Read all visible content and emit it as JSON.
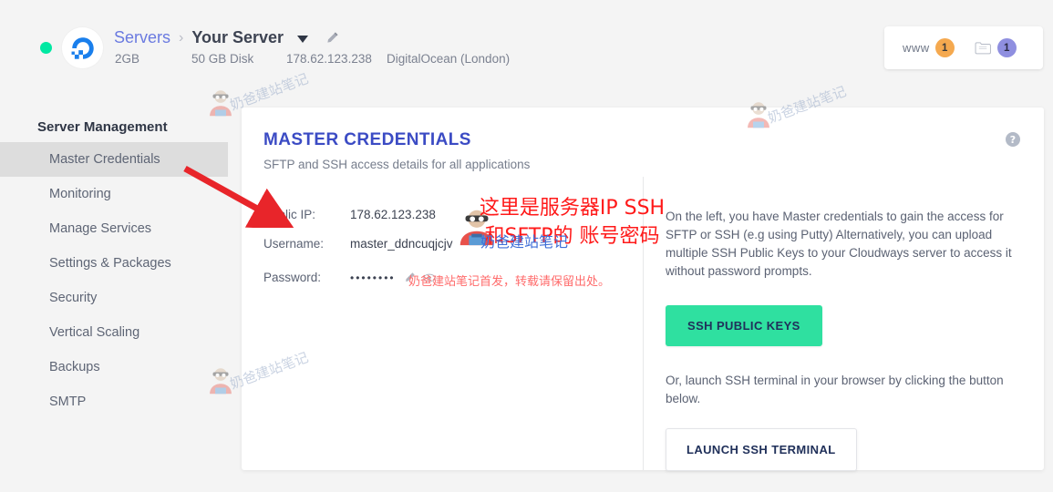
{
  "header": {
    "status": "online",
    "provider_logo": "digitalocean-logo",
    "breadcrumb_root": "Servers",
    "breadcrumb_sep": "›",
    "breadcrumb_current": "Your Server",
    "caret_icon": "chevron-down-icon",
    "edit_icon": "pencil-icon",
    "meta": {
      "ram": "2GB",
      "disk": "50 GB Disk",
      "ip": "178.62.123.238",
      "provider": "DigitalOcean (London)"
    },
    "apps_card": {
      "www_label": "www",
      "www_count": "1",
      "folder_icon": "folder-icon",
      "folder_count": "1"
    }
  },
  "sidebar": {
    "title": "Server Management",
    "items": [
      {
        "label": "Master Credentials",
        "active": true
      },
      {
        "label": "Monitoring",
        "active": false
      },
      {
        "label": "Manage Services",
        "active": false
      },
      {
        "label": "Settings & Packages",
        "active": false
      },
      {
        "label": "Security",
        "active": false
      },
      {
        "label": "Vertical Scaling",
        "active": false
      },
      {
        "label": "Backups",
        "active": false
      },
      {
        "label": "SMTP",
        "active": false
      }
    ]
  },
  "main": {
    "title": "MASTER CREDENTIALS",
    "subtitle": "SFTP and SSH access details for all applications",
    "help_icon": "?",
    "credentials": [
      {
        "label": "Public IP:",
        "value": "178.62.123.238"
      },
      {
        "label": "Username:",
        "value": "master_ddncuqjcjv"
      },
      {
        "label": "Password:",
        "value": "••••••••"
      }
    ],
    "info_paragraph": "On the left, you have Master credentials to gain the access for SFTP or SSH (e.g using Putty) Alternatively, you can upload multiple SSH Public Keys to your Cloudways server to access it without password prompts.",
    "ssh_keys_button": "SSH PUBLIC KEYS",
    "terminal_paragraph": "Or, launch SSH terminal in your browser by clicking the button below.",
    "terminal_button": "LAUNCH SSH TERMINAL"
  },
  "annotations": {
    "red_note": "这里是服务器IP SSH和SFTP的 账号密码",
    "blue_watermark": "奶爸建站笔记",
    "pink_note": "奶爸建站笔记首发，转载请保留出处。",
    "watermark_text": "奶爸建站笔记",
    "arrow": "red-arrow"
  },
  "colors": {
    "accent_blue": "#3b4bc4",
    "link_blue": "#6a7ae0",
    "green": "#2fe0a0",
    "status_green": "#00e8a2",
    "badge_orange": "#f5a94f",
    "badge_purple": "#8f8fe0",
    "annotation_red": "#ff1a1a",
    "page_bg": "#f4f4f4"
  }
}
